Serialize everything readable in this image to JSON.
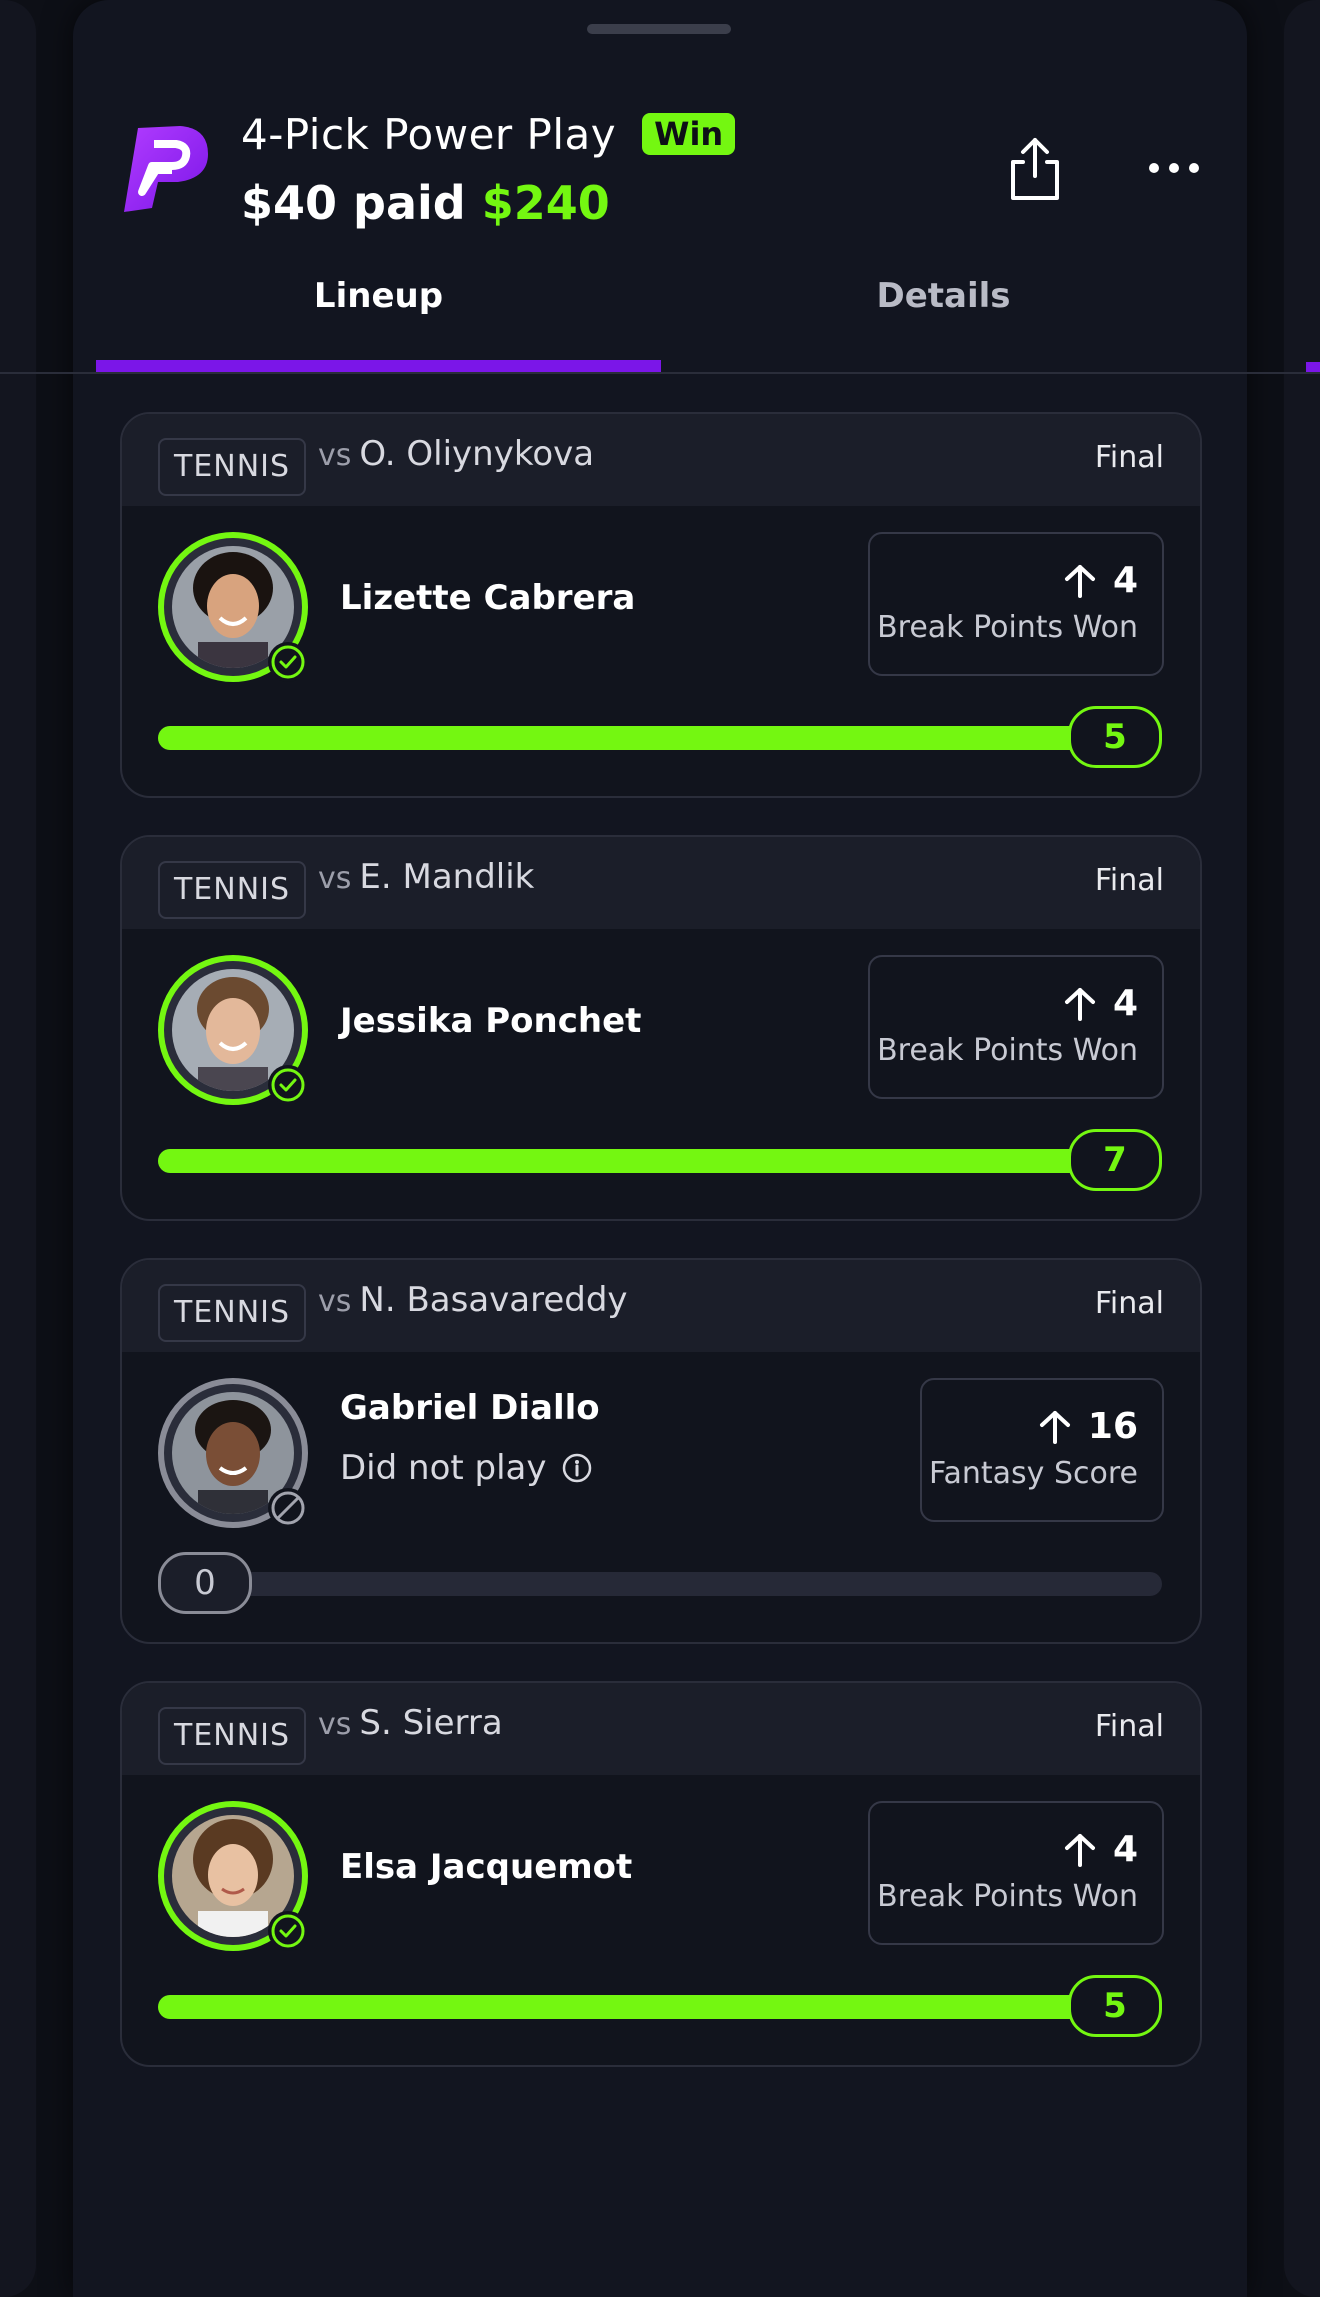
{
  "header": {
    "title": "4-Pick Power Play",
    "badge": "Win",
    "paid_text": "$40 paid",
    "payout": "$240"
  },
  "tabs": [
    {
      "label": "Lineup",
      "active": true
    },
    {
      "label": "Details",
      "active": false
    }
  ],
  "picks": [
    {
      "sport": "TENNIS",
      "vs_word": "vs",
      "opponent": "O. Oliynykova",
      "status": "Final",
      "player": "Lizette Cabrera",
      "stat_value": "4",
      "stat_label": "Break Points Won",
      "result": "5",
      "progress": 1.0,
      "played": true
    },
    {
      "sport": "TENNIS",
      "vs_word": "vs",
      "opponent": "E. Mandlik",
      "status": "Final",
      "player": "Jessika Ponchet",
      "stat_value": "4",
      "stat_label": "Break Points Won",
      "result": "7",
      "progress": 1.0,
      "played": true
    },
    {
      "sport": "TENNIS",
      "vs_word": "vs",
      "opponent": "N. Basavareddy",
      "status": "Final",
      "player": "Gabriel Diallo",
      "note": "Did not play",
      "stat_value": "16",
      "stat_label": "Fantasy Score",
      "result": "0",
      "progress": 0,
      "played": false
    },
    {
      "sport": "TENNIS",
      "vs_word": "vs",
      "opponent": "S. Sierra",
      "status": "Final",
      "player": "Elsa Jacquemot",
      "stat_value": "4",
      "stat_label": "Break Points Won",
      "result": "5",
      "progress": 1.0,
      "played": true
    }
  ],
  "colors": {
    "accent_green": "#74f711",
    "accent_purple": "#7b16e8",
    "background": "#121520"
  },
  "icons": {
    "logo": "prizepicks-logo",
    "share": "share-icon",
    "more": "more-horizontal-icon",
    "arrow": "arrow-up-icon",
    "check": "check-circle-icon",
    "dnp": "not-allowed-icon",
    "info": "info-icon"
  }
}
